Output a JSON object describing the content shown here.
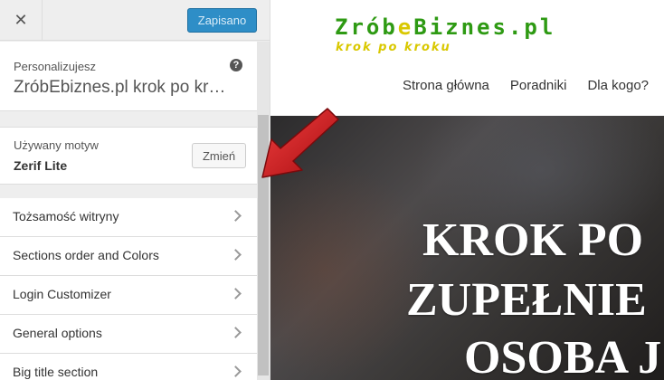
{
  "header": {
    "close_icon": "✕",
    "save_label": "Zapisano"
  },
  "info": {
    "label": "Personalizujesz",
    "site_title": "ZróbEbiznes.pl krok po kr…",
    "help_icon": "?"
  },
  "theme": {
    "label": "Używany motyw",
    "name": "Zerif Lite",
    "change_label": "Zmień"
  },
  "sections": [
    {
      "label": "Tożsamość witryny"
    },
    {
      "label": "Sections order and Colors"
    },
    {
      "label": "Login Customizer"
    },
    {
      "label": "General options"
    },
    {
      "label": "Big title section"
    }
  ],
  "preview": {
    "logo_before": "Zrób",
    "logo_e": "e",
    "logo_after": "Biznes.pl",
    "tagline": "krok po kroku",
    "nav": [
      "Strona główna",
      "Poradniki",
      "Dla kogo?"
    ],
    "hero_lines": [
      "KROK PO",
      "ZUPEŁNIE",
      "OSOBA J"
    ]
  },
  "colors": {
    "save_button": "#2e8ec7",
    "logo_green": "#2e9a13",
    "logo_yellow": "#d9c800",
    "arrow_red": "#c8161a"
  }
}
